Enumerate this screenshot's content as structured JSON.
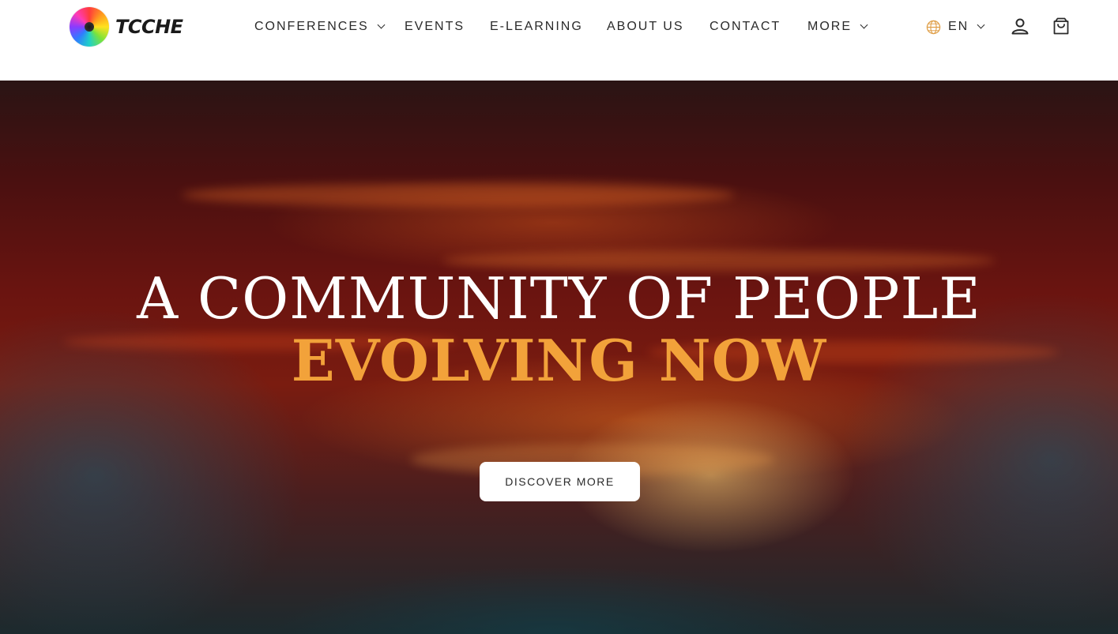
{
  "brand": {
    "name": "TCCHE"
  },
  "nav": {
    "items": [
      {
        "label": "CONFERENCES",
        "has_dropdown": true
      },
      {
        "label": "EVENTS",
        "has_dropdown": false
      },
      {
        "label": "E-LEARNING",
        "has_dropdown": false
      },
      {
        "label": "ABOUT US",
        "has_dropdown": false
      },
      {
        "label": "CONTACT",
        "has_dropdown": false
      },
      {
        "label": "MORE",
        "has_dropdown": true
      }
    ]
  },
  "header_actions": {
    "language": "EN",
    "icons": [
      "globe-icon",
      "user-icon",
      "cart-icon"
    ]
  },
  "hero": {
    "title": "A COMMUNITY OF PEOPLE",
    "subtitle": "EVOLVING NOW",
    "cta_label": "DISCOVER MORE"
  },
  "colors": {
    "accent": "#f2a23a",
    "text": "#2a2a2a",
    "hero_overlay": "#4a1010"
  }
}
